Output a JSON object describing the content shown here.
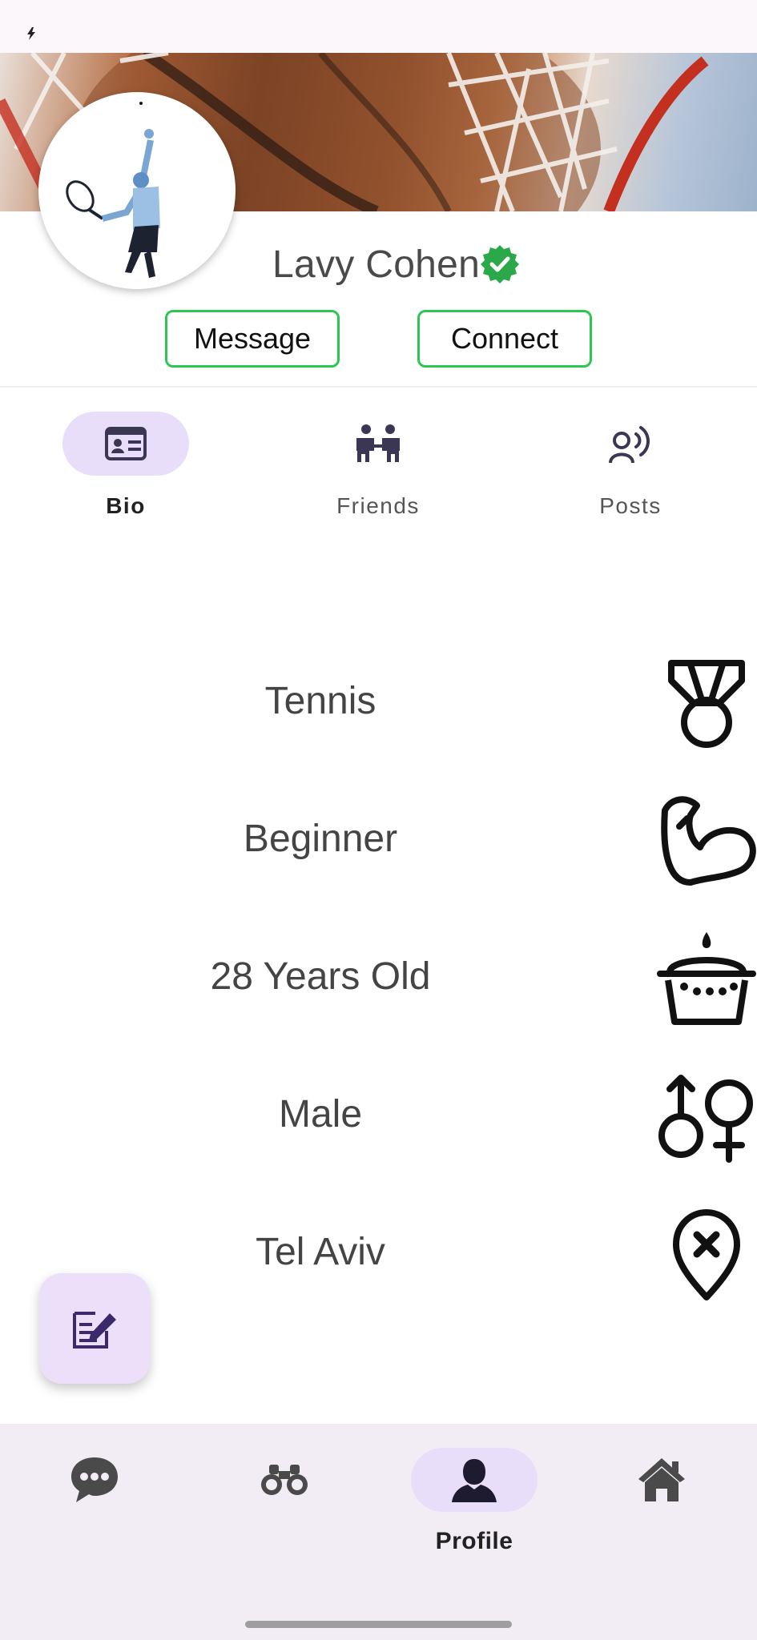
{
  "profile": {
    "name": "Lavy Cohen",
    "verified": true
  },
  "actions": {
    "message_label": "Message",
    "connect_label": "Connect"
  },
  "tabs": [
    {
      "label": "Bio",
      "icon": "id-card-icon",
      "active": true
    },
    {
      "label": "Friends",
      "icon": "people-icon",
      "active": false
    },
    {
      "label": "Posts",
      "icon": "speaking-icon",
      "active": false
    }
  ],
  "bio": [
    {
      "text": "Tennis",
      "icon": "medal-icon"
    },
    {
      "text": "Beginner",
      "icon": "flexed-bicep-icon"
    },
    {
      "text": "28 Years Old",
      "icon": "birthday-cake-icon"
    },
    {
      "text": "Male",
      "icon": "gender-icon"
    },
    {
      "text": "Tel Aviv",
      "icon": "location-pin-icon"
    }
  ],
  "fab": {
    "icon": "edit-note-icon"
  },
  "bottom_nav": [
    {
      "label": "",
      "icon": "chat-icon",
      "active": false
    },
    {
      "label": "",
      "icon": "binoculars-icon",
      "active": false
    },
    {
      "label": "Profile",
      "icon": "person-icon",
      "active": true
    },
    {
      "label": "",
      "icon": "home-icon",
      "active": false
    }
  ],
  "colors": {
    "accent_green": "#2dc653",
    "pill_purple": "#e9defa",
    "nav_bg": "#f2ecf5",
    "icon_dark": "#3b3654"
  }
}
